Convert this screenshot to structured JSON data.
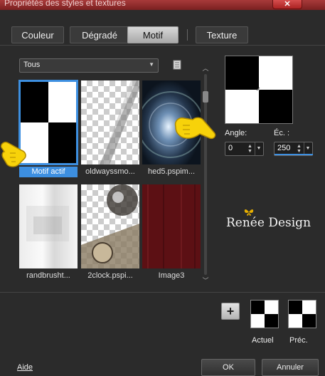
{
  "window": {
    "title": "Propriétés des styles et textures",
    "close_icon": "close-icon"
  },
  "tabs": [
    {
      "label": "Couleur",
      "active": false
    },
    {
      "label": "Dégradé",
      "active": false
    },
    {
      "label": "Motif",
      "active": true
    },
    {
      "label": "Texture",
      "active": false
    }
  ],
  "filter": {
    "selected": "Tous"
  },
  "patterns": [
    {
      "label": "Motif actif",
      "selected": true
    },
    {
      "label": "oldwayssmo...",
      "selected": false
    },
    {
      "label": "hed5.pspim...",
      "selected": false
    },
    {
      "label": "randbrusht...",
      "selected": false
    },
    {
      "label": "2clock.pspi...",
      "selected": false
    },
    {
      "label": "Image3",
      "selected": false
    }
  ],
  "angle": {
    "label": "Angle:",
    "value": "0"
  },
  "scale": {
    "label": "Éc. :",
    "value": "250"
  },
  "watermark": {
    "text": "Renée Design"
  },
  "swatches": {
    "current_label": "Actuel",
    "previous_label": "Préc."
  },
  "footer": {
    "help_label": "Aide",
    "ok_label": "OK",
    "cancel_label": "Annuler"
  },
  "colors": {
    "accent": "#3d8fe0",
    "titlebar": "#8a2a2a",
    "pointer": "#f7d20a",
    "butterfly": "#e8b000"
  }
}
